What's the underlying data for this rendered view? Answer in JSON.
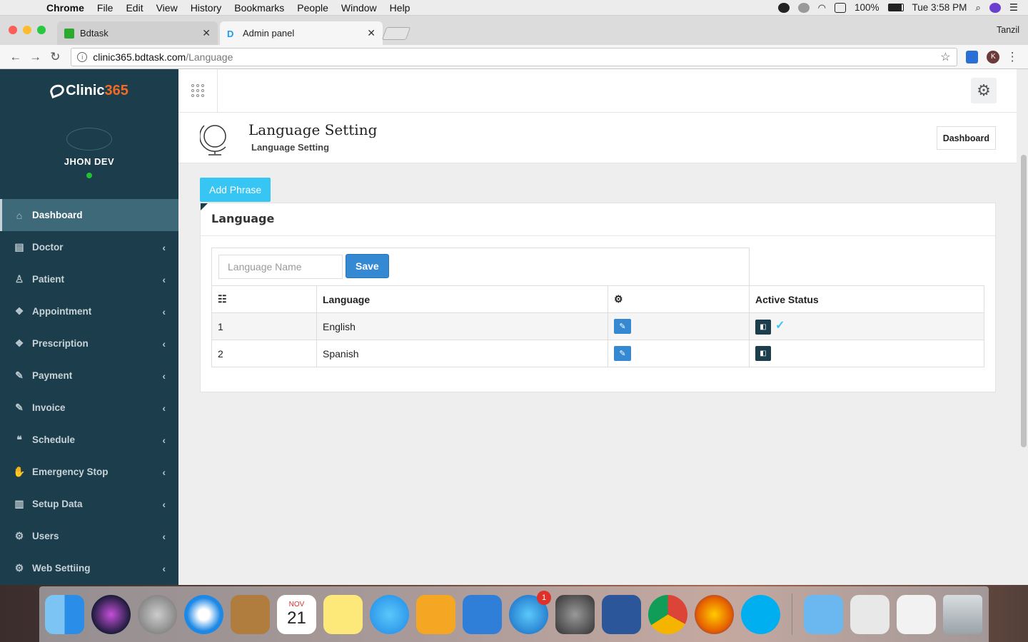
{
  "menubar": {
    "app": "Chrome",
    "items": [
      "File",
      "Edit",
      "View",
      "History",
      "Bookmarks",
      "People",
      "Window",
      "Help"
    ],
    "battery": "100%",
    "clock": "Tue 3:58 PM"
  },
  "browser": {
    "tabs": [
      {
        "title": "Bdtask",
        "favicon_color": "#2ea82e"
      },
      {
        "title": "Admin panel",
        "favicon_color": "#1d9bf0"
      }
    ],
    "profile": "Tanzil",
    "url_host": "clinic365.bdtask.com",
    "url_path": "/Language",
    "ext_avatar": "K"
  },
  "sidebar": {
    "logo_text": "Clinic",
    "logo_num": "365",
    "user_name": "JHON DEV",
    "items": [
      {
        "label": "Dashboard",
        "icon": "home-icon",
        "glyph": "⌂",
        "active": true
      },
      {
        "label": "Doctor",
        "icon": "file-icon",
        "glyph": "▤"
      },
      {
        "label": "Patient",
        "icon": "user-icon",
        "glyph": "♙"
      },
      {
        "label": "Appointment",
        "icon": "cube-icon",
        "glyph": "❖"
      },
      {
        "label": "Prescription",
        "icon": "cube-icon",
        "glyph": "❖"
      },
      {
        "label": "Payment",
        "icon": "pencil-icon",
        "glyph": "✎"
      },
      {
        "label": "Invoice",
        "icon": "pencil-icon",
        "glyph": "✎"
      },
      {
        "label": "Schedule",
        "icon": "comments-icon",
        "glyph": "❝"
      },
      {
        "label": "Emergency Stop",
        "icon": "hand-icon",
        "glyph": "✋"
      },
      {
        "label": "Setup Data",
        "icon": "bar-chart-icon",
        "glyph": "▥"
      },
      {
        "label": "Users",
        "icon": "gears-icon",
        "glyph": "⚙"
      },
      {
        "label": "Web Settiing",
        "icon": "gears-icon",
        "glyph": "⚙"
      }
    ],
    "chevron": "‹"
  },
  "header": {
    "title": "Language Setting",
    "subtitle": "Language Setting",
    "dashboard_button": "Dashboard"
  },
  "content": {
    "add_phrase": "Add Phrase",
    "panel_title": "Language",
    "input_placeholder": "Language Name",
    "save_label": "Save",
    "columns": [
      "",
      "Language",
      "",
      "Active Status"
    ],
    "rows": [
      {
        "num": "1",
        "language": "English",
        "active": true
      },
      {
        "num": "2",
        "language": "Spanish",
        "active": false
      }
    ]
  },
  "dock": {
    "calendar_month": "NOV",
    "calendar_day": "21",
    "appstore_badge": "1"
  }
}
